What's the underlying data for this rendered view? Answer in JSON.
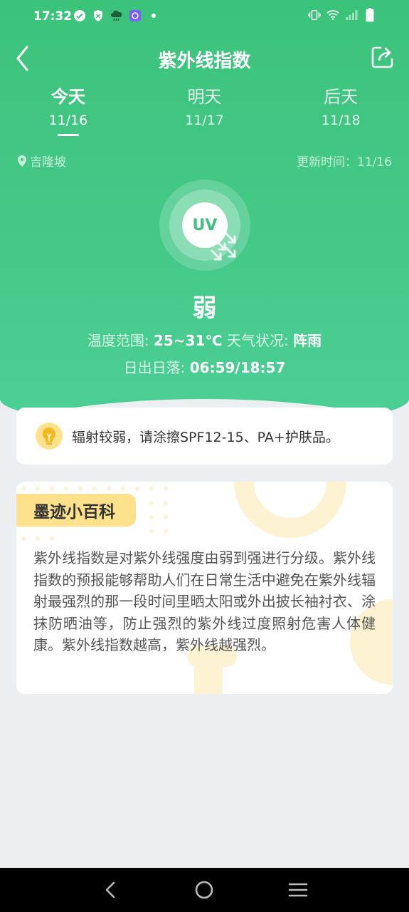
{
  "status": {
    "time": "17:32"
  },
  "nav": {
    "title": "紫外线指数"
  },
  "tabs": [
    {
      "name": "今天",
      "date": "11/16",
      "active": true
    },
    {
      "name": "明天",
      "date": "11/17",
      "active": false
    },
    {
      "name": "后天",
      "date": "11/18",
      "active": false
    }
  ],
  "location": "吉隆坡",
  "update_time": "更新时间：11/16",
  "uv_badge": "UV",
  "level": "弱",
  "temperature_label": "温度范围:",
  "temperature_value": "25~31℃",
  "weather_label": "天气状况:",
  "weather_value": "阵雨",
  "sun_label": "日出日落:",
  "sun_value": "06:59/18:57",
  "tip": "辐射较弱，请涂擦SPF12-15、PA+护肤品。",
  "wiki": {
    "title": "墨迹小百科",
    "body": "紫外线指数是对紫外线强度由弱到强进行分级。紫外线指数的预报能够帮助人们在日常生活中避免在紫外线辐射最强烈的那一段时间里晒太阳或外出披长袖衬衣、涂抹防晒油等，防止强烈的紫外线过度照射危害人体健康。紫外线指数越高，紫外线越强烈。"
  },
  "colors": {
    "accent": "#3cc37a",
    "badge": "#fde18b",
    "background": "#eceff1"
  }
}
